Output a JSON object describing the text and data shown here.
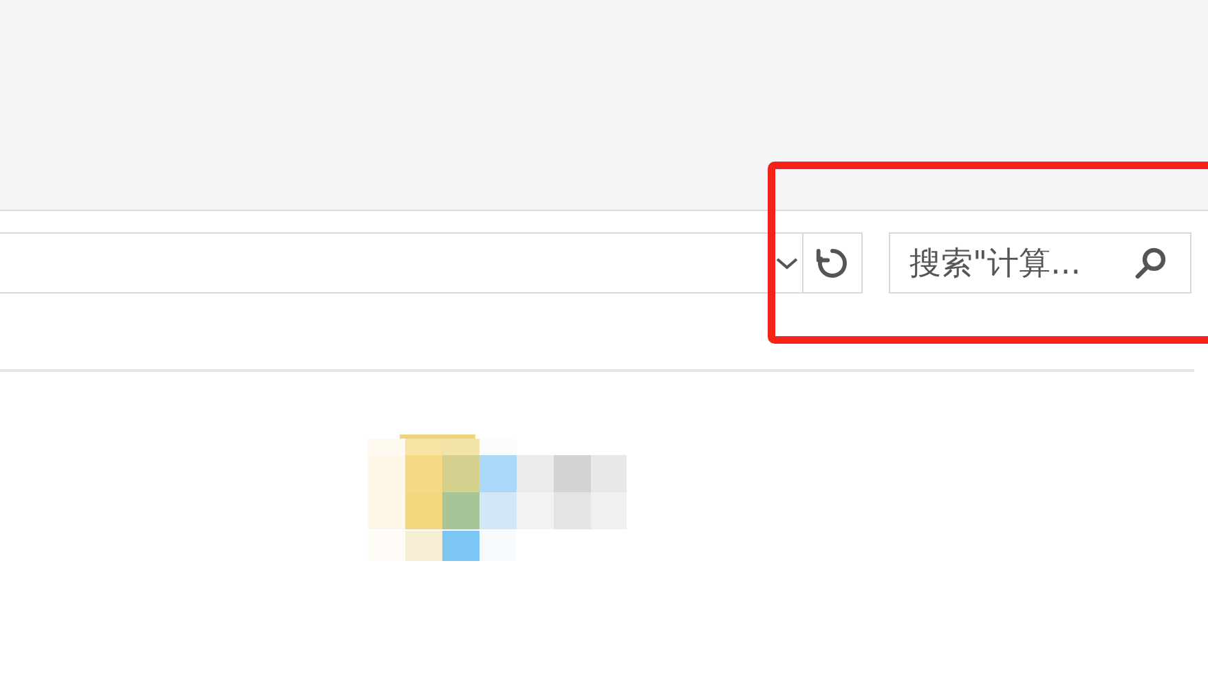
{
  "address_bar": {
    "history_dropdown": true
  },
  "search": {
    "placeholder": "搜索\"计算..."
  },
  "highlight": {
    "on": true
  }
}
